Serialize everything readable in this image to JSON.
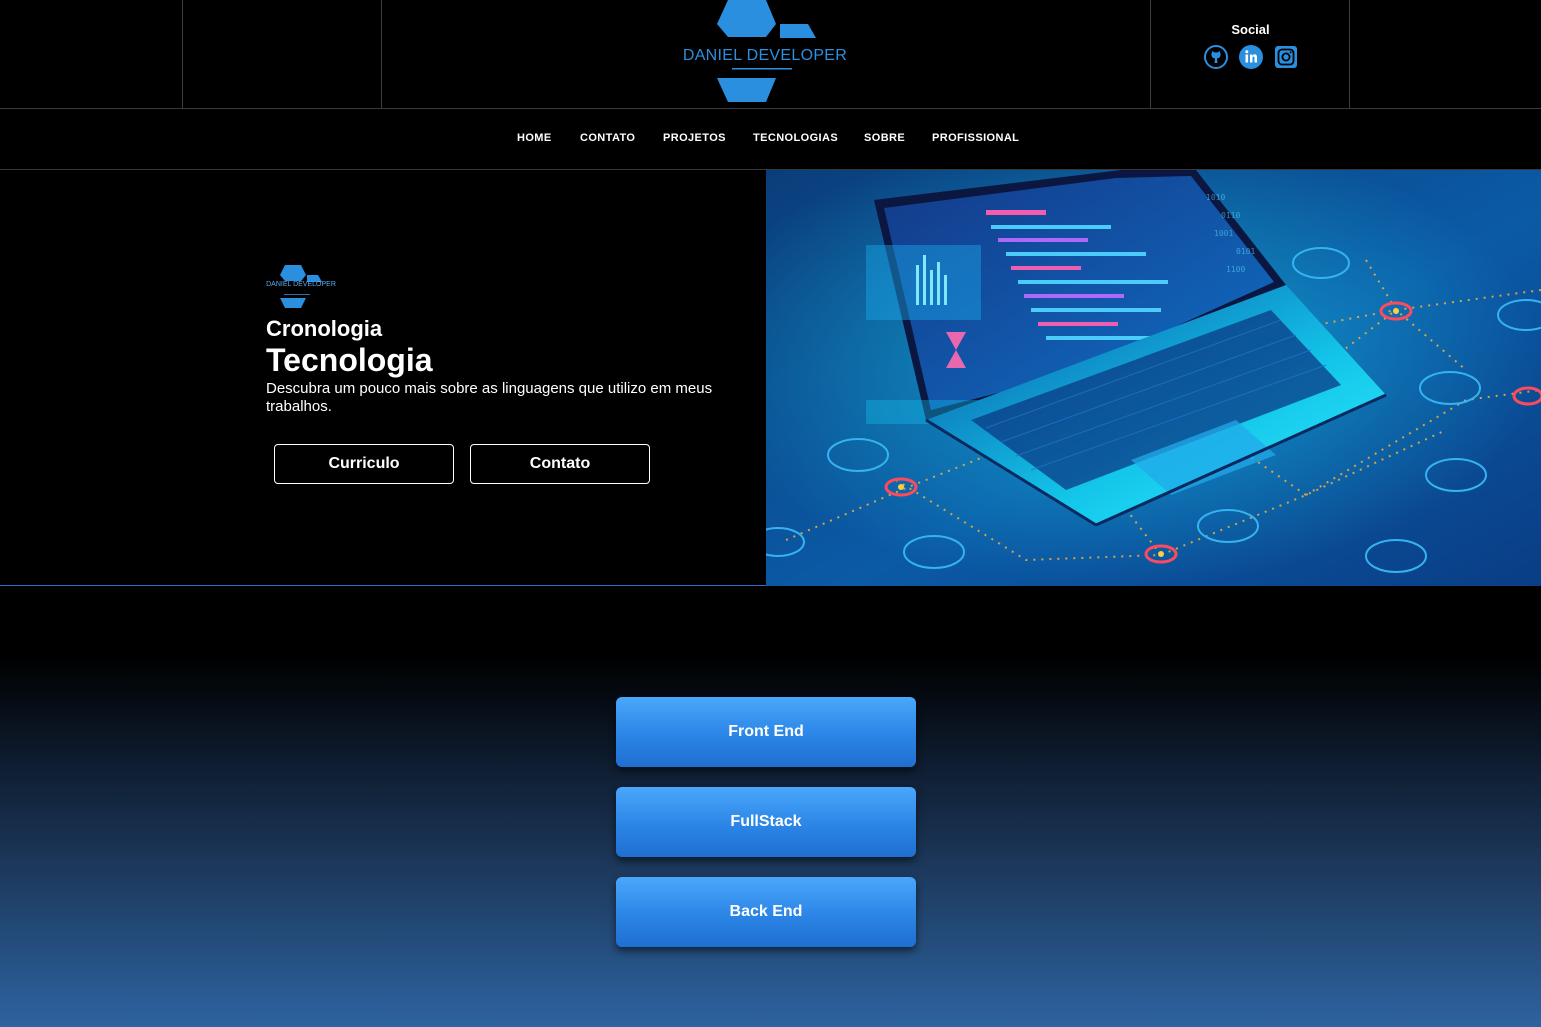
{
  "brand": {
    "name": "DANIEL DEVELOPER",
    "accent_color": "#2b8fe0"
  },
  "social": {
    "title": "Social",
    "icons": [
      "github-icon",
      "linkedin-icon",
      "instagram-icon"
    ]
  },
  "nav": {
    "items": [
      {
        "label": "HOME"
      },
      {
        "label": "CONTATO"
      },
      {
        "label": "PROJETOS"
      },
      {
        "label": "TECNOLOGIAS"
      },
      {
        "label": "SOBRE"
      },
      {
        "label": "PROFISSIONAL"
      }
    ]
  },
  "hero": {
    "logo_text": "DANIEL DEVELOPER",
    "kicker": "Cronologia",
    "title": "Tecnologia",
    "description": "Descubra um pouco mais sobre as linguagens que utilizo em meus trabalhos.",
    "buttons": [
      {
        "label": "Curriculo"
      },
      {
        "label": "Contato"
      }
    ],
    "image": "laptop-illustration"
  },
  "tech": {
    "buttons": [
      {
        "label": "Front End"
      },
      {
        "label": "FullStack"
      },
      {
        "label": "Back End"
      }
    ]
  }
}
